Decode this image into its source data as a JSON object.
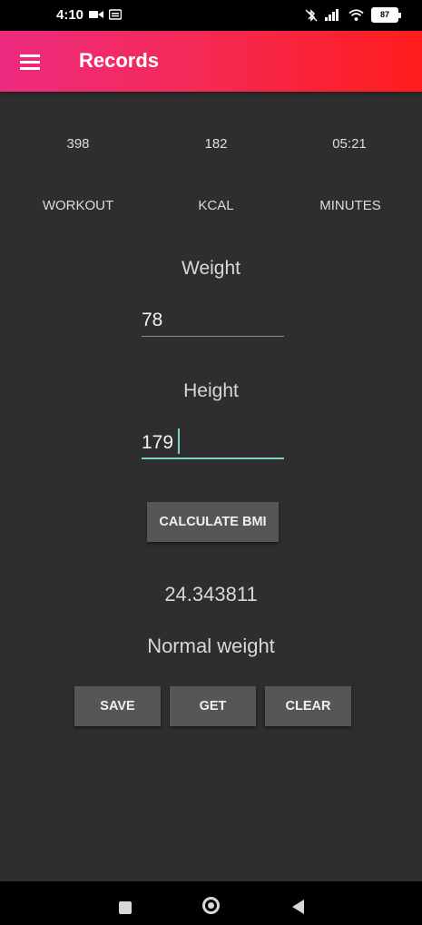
{
  "status_bar": {
    "time": "4:10",
    "battery": "87"
  },
  "app_bar": {
    "title": "Records",
    "gradient_start": "#ee2a7f",
    "gradient_end": "#ff1c1c"
  },
  "stats": [
    {
      "value": "398",
      "label": "WORKOUT"
    },
    {
      "value": "182",
      "label": "KCAL"
    },
    {
      "value": "05:21",
      "label": "MINUTES"
    }
  ],
  "form": {
    "weight_label": "Weight",
    "weight_value": "78",
    "height_label": "Height",
    "height_value": "179",
    "calculate_label": "CALCULATE BMI"
  },
  "result": {
    "bmi_value": "24.343811",
    "category": "Normal weight"
  },
  "actions": {
    "save_label": "SAVE",
    "get_label": "GET",
    "clear_label": "CLEAR"
  },
  "colors": {
    "background": "#2e2e2e",
    "button": "#565656",
    "focus_underline": "#7fd0c8"
  }
}
